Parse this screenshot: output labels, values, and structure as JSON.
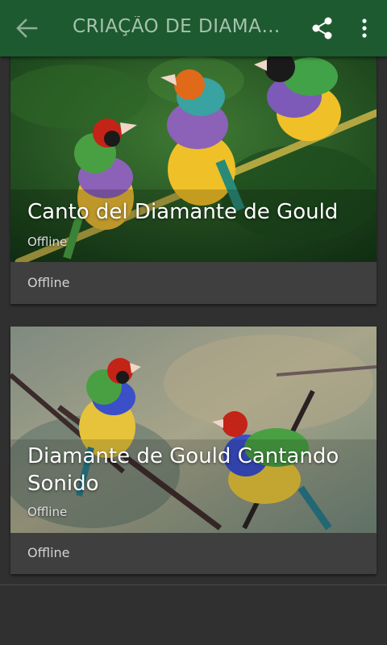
{
  "appbar": {
    "title": "CRIAÇÃO DE DIAMANTES",
    "back_icon": "arrow-back-icon",
    "share_icon": "share-icon",
    "more_icon": "more-vert-icon",
    "color": "#1d5a30"
  },
  "cards": [
    {
      "title": "Canto del Diamante de Gould",
      "subtitle": "Offline",
      "footer": "Offline"
    },
    {
      "title_line1": "Diamante de Gould Cantando",
      "title_line2": "Sonido",
      "subtitle": "Offline",
      "footer": "Offline"
    }
  ]
}
